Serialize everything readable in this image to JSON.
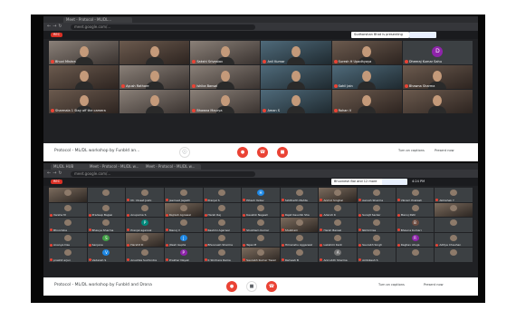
{
  "shot1": {
    "tabs": [
      "Meet - Protocol - ML/DL..."
    ],
    "url": "meet.google.com/...",
    "rec_label": "REC",
    "presenting_label": "Sudharshan Bhat is presenting",
    "participants": [
      {
        "name": "Bhuvi Mishra",
        "kind": "video",
        "tone": "cam2"
      },
      {
        "name": "",
        "kind": "video",
        "tone": "cam"
      },
      {
        "name": "Sakshi Srivastav",
        "kind": "video",
        "tone": "cam2"
      },
      {
        "name": "Anil Kumar",
        "kind": "video",
        "tone": "cam3"
      },
      {
        "name": "Suresh H Upadhyaya",
        "kind": "video",
        "tone": "cam"
      },
      {
        "name": "Dheeraj Kumar Sahu",
        "kind": "avatar",
        "letter": "D",
        "color": "#8e24aa"
      },
      {
        "name": "",
        "kind": "video",
        "tone": "cam"
      },
      {
        "name": "Ayush Rathore",
        "kind": "video",
        "tone": "cam2"
      },
      {
        "name": "Ishika Bansal",
        "kind": "video",
        "tone": "cam2"
      },
      {
        "name": "",
        "kind": "video",
        "tone": "cam3"
      },
      {
        "name": "Sahil Jain",
        "kind": "video",
        "tone": "cam3"
      },
      {
        "name": "Bhawna Sharma",
        "kind": "video",
        "tone": "cam"
      },
      {
        "name": "Sharmala 1 Stay off the camera",
        "kind": "video",
        "tone": "cam"
      },
      {
        "name": "",
        "kind": "video",
        "tone": "cam2"
      },
      {
        "name": "Bhawna Maurya",
        "kind": "video",
        "tone": "cam2"
      },
      {
        "name": "Aman S",
        "kind": "video",
        "tone": "cam3"
      },
      {
        "name": "Rohan V",
        "kind": "video",
        "tone": "cam"
      },
      {
        "name": "",
        "kind": "video",
        "tone": "cam"
      }
    ],
    "meeting_title": "Protocol - ML/DL workshop by Funbld an...",
    "captions_label": "Turn on captions",
    "present_label": "Present now"
  },
  "shot2": {
    "tabs": [
      "ML/DL HUB",
      "Meet - Protocol - ML/DL w...",
      "Meet - Protocol - ML/DL w..."
    ],
    "url": "meet.google.com/...",
    "rec_label": "REC",
    "presenting_label": "Bhuvnesh Bal and 12 more",
    "time": "4:24 PM",
    "participants": [
      {
        "name": "",
        "kind": "pic"
      },
      {
        "name": "",
        "kind": "pic"
      },
      {
        "name": "Mr. Vineet Joshi",
        "kind": "pic"
      },
      {
        "name": "Jasmeet Jagadh",
        "kind": "pic"
      },
      {
        "name": "Pranjal S",
        "kind": "pic"
      },
      {
        "name": "Hitesh Yadav",
        "kind": "avatar",
        "letter": "H",
        "color": "#1e88e5"
      },
      {
        "name": "Siddharth Mehta",
        "kind": "pic"
      },
      {
        "name": "Anmol Singhal",
        "kind": "pic"
      },
      {
        "name": "Aarush Sharma",
        "kind": "pic"
      },
      {
        "name": "Vikram Prakash",
        "kind": "pic"
      },
      {
        "name": "Abhishek Y",
        "kind": "pic"
      },
      {
        "name": "Varsha M",
        "kind": "pic"
      },
      {
        "name": "Pradeep Bajpai",
        "kind": "pic"
      },
      {
        "name": "Anupama S",
        "kind": "pic"
      },
      {
        "name": "Rajnish Agrawal",
        "kind": "pic"
      },
      {
        "name": "Harsh Raj",
        "kind": "pic"
      },
      {
        "name": "Kaushik Nagesh",
        "kind": "pic"
      },
      {
        "name": "Rajat Kaushik Sha",
        "kind": "pic"
      },
      {
        "name": "Adarsh K",
        "kind": "pic"
      },
      {
        "name": "Surajit Sarkar",
        "kind": "pic"
      },
      {
        "name": "Manoj Patil",
        "kind": "pic"
      },
      {
        "name": "",
        "kind": "pic"
      },
      {
        "name": "Bhoomika",
        "kind": "pic"
      },
      {
        "name": "Bhavya Sharma",
        "kind": "pic"
      },
      {
        "name": "Pranjal agarwal",
        "kind": "avatar",
        "letter": "P",
        "color": "#00897b"
      },
      {
        "name": "Manoj V",
        "kind": "pic"
      },
      {
        "name": "Rashmi Agarwal",
        "kind": "pic"
      },
      {
        "name": "Shubham Kumar",
        "kind": "pic"
      },
      {
        "name": "Shubham",
        "kind": "pic"
      },
      {
        "name": "Harsh Bansal",
        "kind": "pic"
      },
      {
        "name": "Nikhil Das",
        "kind": "pic"
      },
      {
        "name": "Bhavna Kumari",
        "kind": "avatar",
        "letter": "B",
        "color": "#6d4c41"
      },
      {
        "name": "",
        "kind": "pic"
      },
      {
        "name": "Ananya Das",
        "kind": "pic"
      },
      {
        "name": "Sanjana",
        "kind": "avatar",
        "letter": "S",
        "color": "#43a047"
      },
      {
        "name": "Harshit D",
        "kind": "pic"
      },
      {
        "name": "Jitesh Gupta",
        "kind": "avatar",
        "letter": "J",
        "color": "#1e88e5"
      },
      {
        "name": "Bhuvnesh Sharma",
        "kind": "pic"
      },
      {
        "name": "Tejas M",
        "kind": "pic"
      },
      {
        "name": "Himanshu Aggarwal",
        "kind": "pic"
      },
      {
        "name": "Lakshmi Kant",
        "kind": "pic"
      },
      {
        "name": "Saurabh Singh",
        "kind": "pic"
      },
      {
        "name": "Raghav Ahuja",
        "kind": "avatar",
        "letter": "R",
        "color": "#8e24aa"
      },
      {
        "name": "Aditya Chauhan",
        "kind": "pic"
      },
      {
        "name": "prashit arjun",
        "kind": "pic"
      },
      {
        "name": "Vedansh S",
        "kind": "avatar",
        "letter": "V",
        "color": "#1e88e5"
      },
      {
        "name": "Anushka Suchindra",
        "kind": "pic"
      },
      {
        "name": "Prakhar Nayak",
        "kind": "avatar",
        "letter": "P",
        "color": "#8e24aa"
      },
      {
        "name": "K Shrihara Rama",
        "kind": "pic"
      },
      {
        "name": "Saurabh Kumar Tiwari",
        "kind": "pic"
      },
      {
        "name": "Ramesh B",
        "kind": "pic"
      },
      {
        "name": "Aniruddh Sharma",
        "kind": "avatar",
        "letter": "A",
        "color": "#757575"
      },
      {
        "name": "Ambikesh S",
        "kind": "pic"
      },
      {
        "name": "",
        "kind": "pic"
      },
      {
        "name": "",
        "kind": "pic"
      }
    ],
    "meeting_title": "Protocol - ML/DL workshop by Funbld and Drona",
    "captions_label": "Turn on captions",
    "present_label": "Present now"
  }
}
